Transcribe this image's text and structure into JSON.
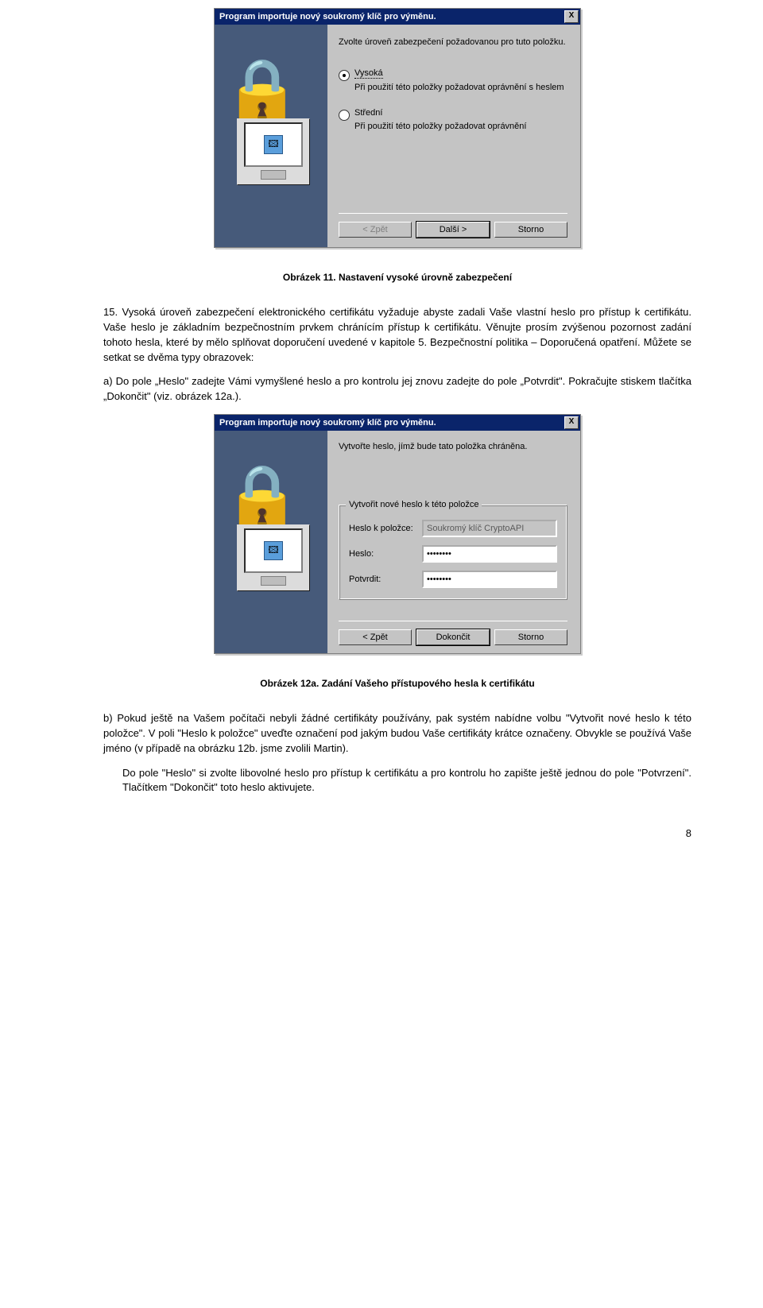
{
  "dialog1": {
    "title": "Program importuje nový soukromý klíč pro výměnu.",
    "close_x": "X",
    "intro": "Zvolte úroveň zabezpečení požadovanou pro tuto položku.",
    "option_high": {
      "title": "Vysoká",
      "desc": "Při použití této položky požadovat oprávnění s heslem"
    },
    "option_medium": {
      "title": "Střední",
      "desc": "Při použití této položky požadovat oprávnění"
    },
    "btn_back": "< Zpět",
    "btn_next": "Další >",
    "btn_cancel": "Storno"
  },
  "caption1": "Obrázek 11. Nastavení vysoké úrovně zabezpečení",
  "para15": "15. Vysoká úroveň zabezpečení elektronického certifikátu vyžaduje abyste zadali Vaše vlastní heslo pro přístup k certifikátu. Vaše heslo je základním bezpečnostním prvkem chránícím přístup k certifikátu. Věnujte prosím zvýšenou pozornost zadání tohoto hesla, které by mělo splňovat doporučení uvedené v kapitole 5. Bezpečnostní politika – Doporučená opatření. Můžete se setkat se dvěma typy obrazovek:",
  "para_a": "a) Do pole „Heslo\" zadejte Vámi vymyšlené heslo a pro kontrolu jej znovu zadejte do pole „Potvrdit\". Pokračujte stiskem tlačítka „Dokončit\" (viz. obrázek 12a.).",
  "dialog2": {
    "title": "Program importuje nový soukromý klíč pro výměnu.",
    "close_x": "X",
    "intro": "Vytvořte heslo, jímž bude tato položka chráněna.",
    "group_legend": "Vytvořit nové heslo k této položce",
    "label_item": "Heslo k položce:",
    "value_item": "Soukromý klíč CryptoAPI",
    "label_pwd": "Heslo:",
    "value_pwd": "••••••••",
    "label_confirm": "Potvrdit:",
    "value_confirm": "••••••••",
    "btn_back": "< Zpět",
    "btn_finish": "Dokončit",
    "btn_cancel": "Storno"
  },
  "caption2": "Obrázek 12a. Zadání Vašeho přístupového hesla k certifikátu",
  "para_b1": "b) Pokud ještě na Vašem počítači nebyli žádné certifikáty používány, pak systém nabídne volbu \"Vytvořit nové heslo k této položce\". V poli \"Heslo k položce\" uveďte označení pod jakým budou Vaše certifikáty krátce označeny. Obvykle se používá Vaše jméno (v případě na obrázku 12b. jsme zvolili Martin).",
  "para_b2": "Do pole \"Heslo\" si zvolte libovolné heslo pro přístup k certifikátu a pro kontrolu ho zapište ještě jednou do pole \"Potvrzení\". Tlačítkem \"Dokončit\" toto heslo aktivujete.",
  "page_number": "8"
}
